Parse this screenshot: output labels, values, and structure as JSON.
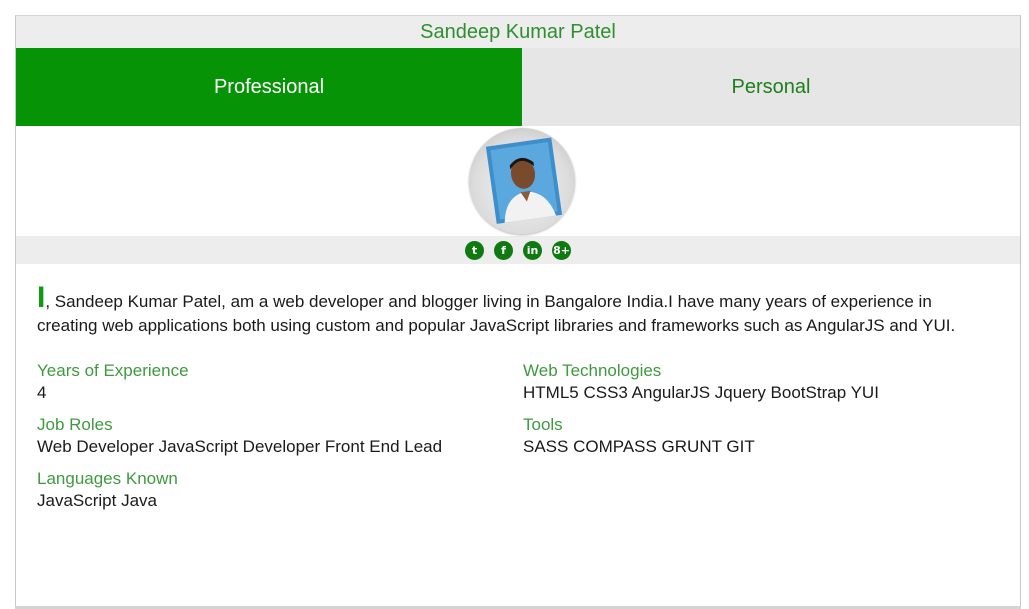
{
  "profile": {
    "name": "Sandeep Kumar Patel"
  },
  "tabs": [
    {
      "label": "Professional",
      "active": true
    },
    {
      "label": "Personal",
      "active": false
    }
  ],
  "social": [
    {
      "icon": "twitter-icon",
      "glyph": "t"
    },
    {
      "icon": "facebook-icon",
      "glyph": "f"
    },
    {
      "icon": "linkedin-icon",
      "glyph": "in"
    },
    {
      "icon": "google-plus-icon",
      "glyph": "8+"
    }
  ],
  "bio": {
    "initial": "I",
    "text": ", Sandeep Kumar Patel, am a web developer and blogger living in Bangalore India.I have many years of experience in creating web applications both using custom and popular JavaScript libraries and frameworks such as AngularJS and YUI."
  },
  "details": {
    "years_label": "Years of Experience",
    "years_value": "4",
    "webtech_label": "Web Technologies",
    "webtech_value": "HTML5 CSS3 AngularJS Jquery BootStrap YUI",
    "roles_label": "Job Roles",
    "roles_value": "Web Developer JavaScript Developer Front End Lead",
    "tools_label": "Tools",
    "tools_value": "SASS COMPASS GRUNT GIT",
    "languages_label": "Languages Known",
    "languages_value": "JavaScript Java"
  },
  "colors": {
    "accent": "#069306",
    "accent_text": "#3f9a3f",
    "tab_inactive_bg": "#e6e6e6",
    "bar_bg": "#ededed"
  }
}
